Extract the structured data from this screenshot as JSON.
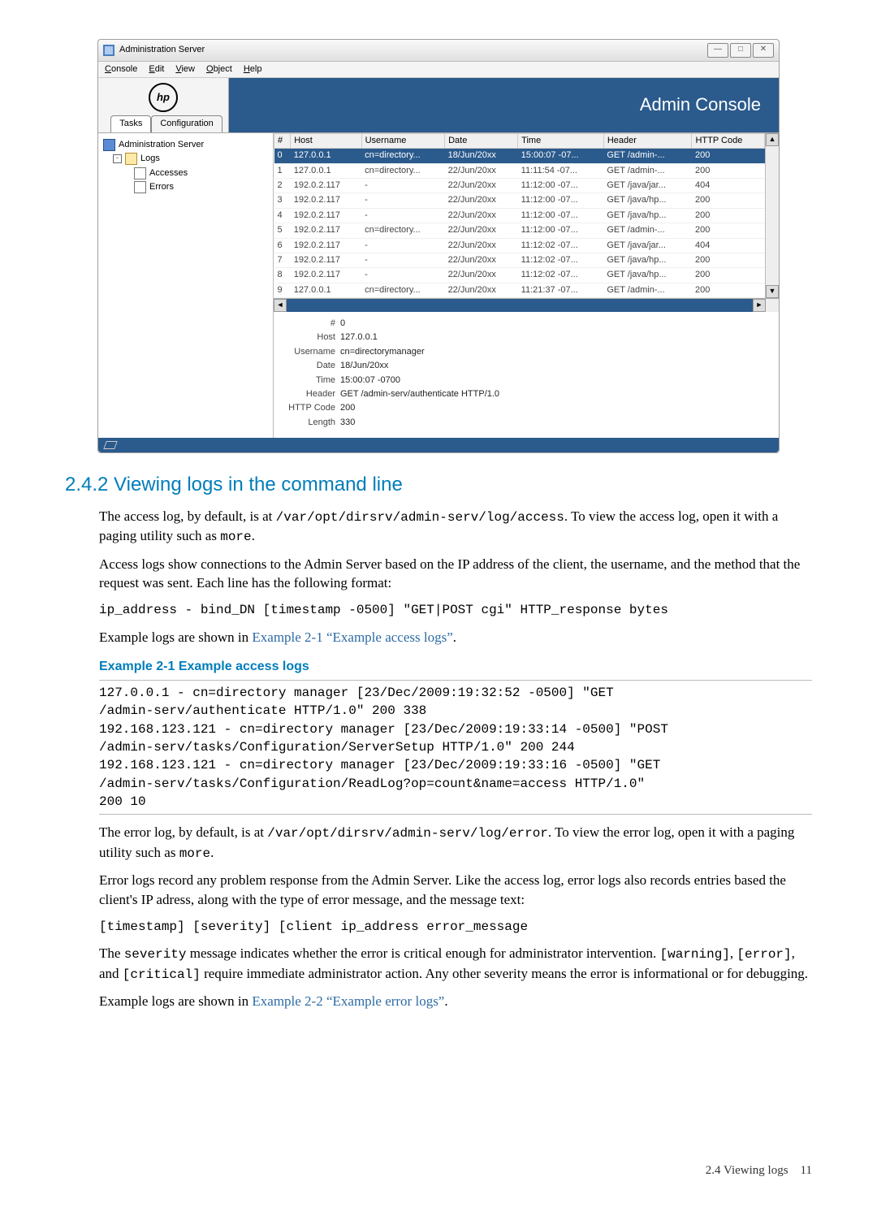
{
  "window": {
    "title": "Administration Server",
    "menus": [
      "Console",
      "Edit",
      "View",
      "Object",
      "Help"
    ],
    "brand": "Admin Console",
    "tabs": [
      "Tasks",
      "Configuration"
    ],
    "activeTab": 0,
    "tree": {
      "root": "Administration Server",
      "logs": "Logs",
      "accesses": "Accesses",
      "errors": "Errors"
    },
    "columns": [
      "#",
      "Host",
      "Username",
      "Date",
      "Time",
      "Header",
      "HTTP Code"
    ],
    "rows": [
      {
        "n": "0",
        "host": "127.0.0.1",
        "user": "cn=directory...",
        "date": "18/Jun/20xx",
        "time": "15:00:07 -07...",
        "hdr": "GET /admin-...",
        "code": "200"
      },
      {
        "n": "1",
        "host": "127.0.0.1",
        "user": "cn=directory...",
        "date": "22/Jun/20xx",
        "time": "11:11:54 -07...",
        "hdr": "GET /admin-...",
        "code": "200"
      },
      {
        "n": "2",
        "host": "192.0.2.117",
        "user": "-",
        "date": "22/Jun/20xx",
        "time": "11:12:00 -07...",
        "hdr": "GET /java/jar...",
        "code": "404"
      },
      {
        "n": "3",
        "host": "192.0.2.117",
        "user": "-",
        "date": "22/Jun/20xx",
        "time": "11:12:00 -07...",
        "hdr": "GET /java/hp...",
        "code": "200"
      },
      {
        "n": "4",
        "host": "192.0.2.117",
        "user": "-",
        "date": "22/Jun/20xx",
        "time": "11:12:00 -07...",
        "hdr": "GET /java/hp...",
        "code": "200"
      },
      {
        "n": "5",
        "host": "192.0.2.117",
        "user": "cn=directory...",
        "date": "22/Jun/20xx",
        "time": "11:12:00 -07...",
        "hdr": "GET /admin-...",
        "code": "200"
      },
      {
        "n": "6",
        "host": "192.0.2.117",
        "user": "-",
        "date": "22/Jun/20xx",
        "time": "11:12:02 -07...",
        "hdr": "GET /java/jar...",
        "code": "404"
      },
      {
        "n": "7",
        "host": "192.0.2.117",
        "user": "-",
        "date": "22/Jun/20xx",
        "time": "11:12:02 -07...",
        "hdr": "GET /java/hp...",
        "code": "200"
      },
      {
        "n": "8",
        "host": "192.0.2.117",
        "user": "-",
        "date": "22/Jun/20xx",
        "time": "11:12:02 -07...",
        "hdr": "GET /java/hp...",
        "code": "200"
      },
      {
        "n": "9",
        "host": "127.0.0.1",
        "user": "cn=directory...",
        "date": "22/Jun/20xx",
        "time": "11:21:37 -07...",
        "hdr": "GET /admin-...",
        "code": "200"
      }
    ],
    "detail": {
      "n_label": "#",
      "n": "0",
      "host_label": "Host",
      "host": "127.0.0.1",
      "user_label": "Username",
      "user": "cn=directorymanager",
      "date_label": "Date",
      "date": "18/Jun/20xx",
      "time_label": "Time",
      "time": "15:00:07 -0700",
      "header_label": "Header",
      "header": "GET /admin-serv/authenticate HTTP/1.0",
      "code_label": "HTTP Code",
      "code": "200",
      "len_label": "Length",
      "len": "330"
    }
  },
  "doc": {
    "sec_title": "2.4.2 Viewing logs in the command line",
    "p1a": "The access log, by default, is at ",
    "p1code": "/var/opt/dirsrv/admin-serv/log/access",
    "p1b": ". To view the access log, open it with a paging utility such as ",
    "p1c": "more",
    "p1d": ".",
    "p2": "Access logs show connections to the Admin Server based on the IP address of the client, the username, and the method that the request was sent. Each line has the following format:",
    "fmt1": "ip_address - bind_DN [timestamp -0500] \"GET|POST cgi\" HTTP_response bytes",
    "p3a": "Example logs are shown in ",
    "p3link": "Example 2-1 “Example access logs”",
    "p3b": ".",
    "ex1_title": "Example 2-1 Example access logs",
    "ex1_body": "127.0.0.1 - cn=directory manager [23/Dec/2009:19:32:52 -0500] \"GET\n/admin-serv/authenticate HTTP/1.0\" 200 338\n192.168.123.121 - cn=directory manager [23/Dec/2009:19:33:14 -0500] \"POST\n/admin-serv/tasks/Configuration/ServerSetup HTTP/1.0\" 200 244\n192.168.123.121 - cn=directory manager [23/Dec/2009:19:33:16 -0500] \"GET\n/admin-serv/tasks/Configuration/ReadLog?op=count&name=access HTTP/1.0\"\n200 10",
    "p4a": "The error log, by default, is at ",
    "p4code": "/var/opt/dirsrv/admin-serv/log/error",
    "p4b": ". To view the error log, open it with a paging utility such as ",
    "p4c": "more",
    "p4d": ".",
    "p5": "Error logs record any problem response from the Admin Server. Like the access log, error logs also records entries based the client's IP adress, along with the type of error message, and the message text:",
    "fmt2": "[timestamp] [severity] [client ip_address error_message",
    "p6a": "The ",
    "p6b": "severity",
    "p6c": " message indicates whether the error is critical enough for administrator intervention. ",
    "p6d": "[warning]",
    "p6e": ", ",
    "p6f": "[error]",
    "p6g": ", and ",
    "p6h": "[critical]",
    "p6i": " require immediate administrator action. Any other severity means the error is informational or for debugging.",
    "p7a": "Example logs are shown in ",
    "p7link": "Example 2-2 “Example error logs”",
    "p7b": ".",
    "footer_text": "2.4 Viewing logs",
    "footer_page": "11"
  }
}
